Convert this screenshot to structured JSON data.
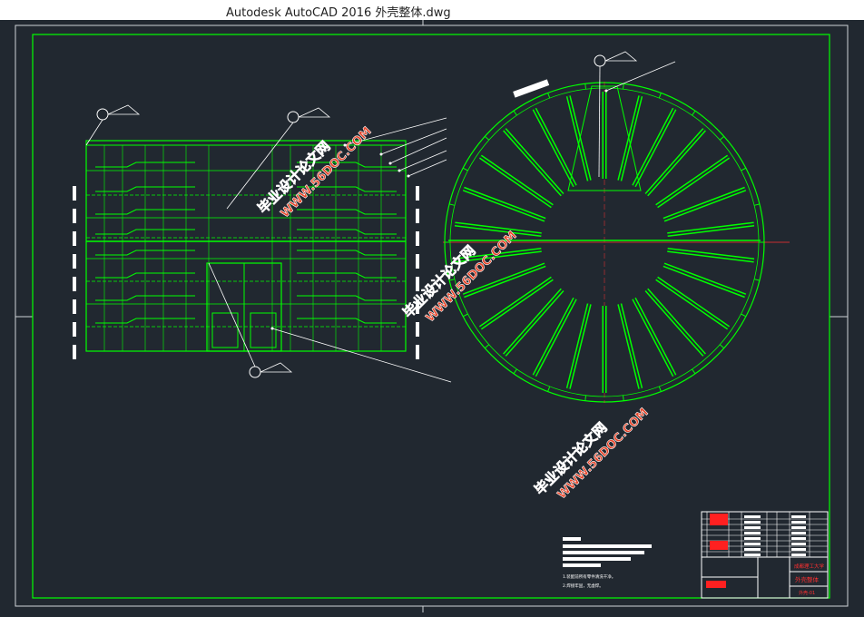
{
  "window": {
    "title": "Autodesk AutoCAD 2016    外壳整体.dwg"
  },
  "colors": {
    "background": "#212830",
    "frame": "#00ff00",
    "lines": "#ffffff",
    "watermark": "#e8452a",
    "stamp": "#ff2020"
  },
  "watermarks": [
    {
      "line1": "毕业设计论文网",
      "line2": "WWW.56DOC.COM"
    },
    {
      "line1": "毕业设计论文网",
      "line2": "WWW.56DOC.COM"
    },
    {
      "line1": "毕业设计论文网",
      "line2": "WWW.56DOC.COM"
    }
  ],
  "title_block": {
    "school": "成都理工大学",
    "drawing_name": "外壳整体",
    "sheet": "外壳-01"
  },
  "notes": {
    "line1": "1.装配前所有零件清洗干净。",
    "line2": "2.焊接牢固，无虚焊。"
  }
}
